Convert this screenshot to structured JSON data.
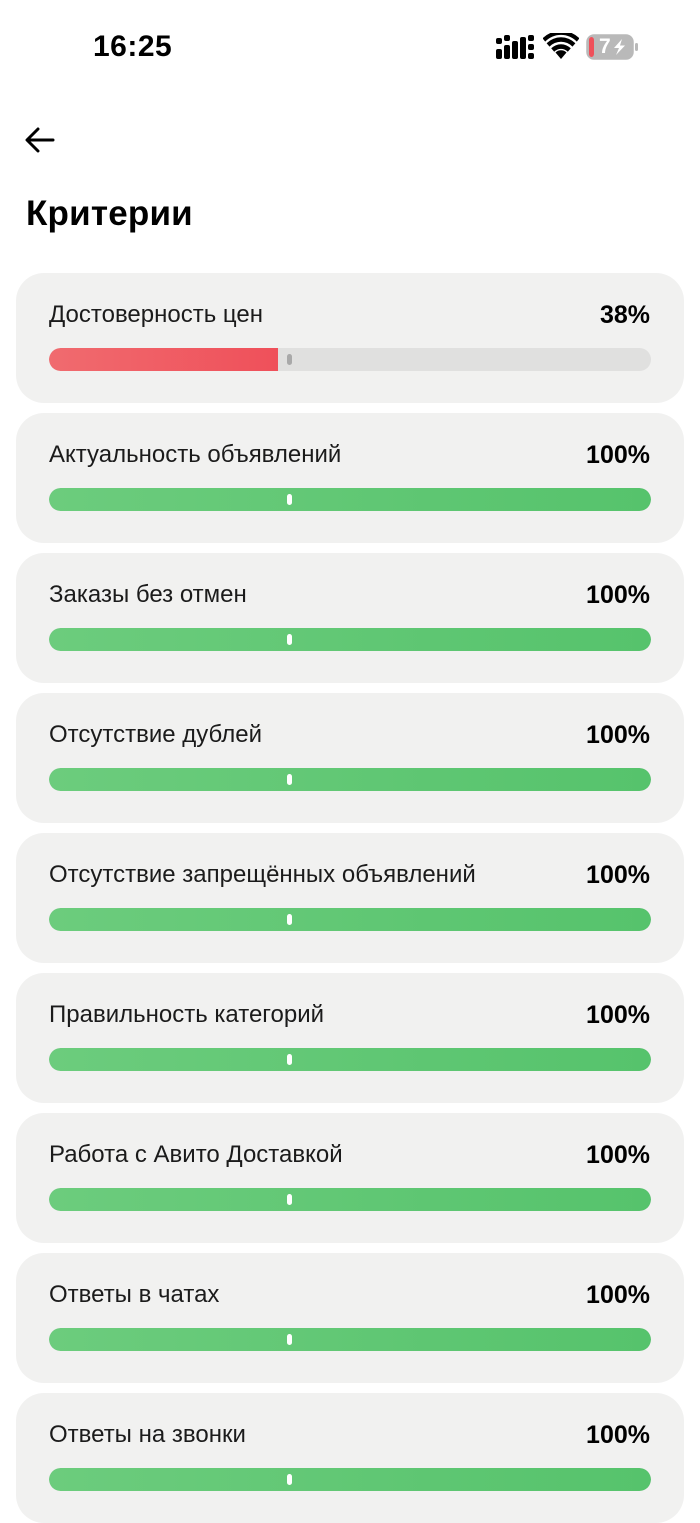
{
  "status_bar": {
    "time": "16:25",
    "battery_level": "7",
    "icons": [
      "signal-icon",
      "wifi-icon",
      "battery-charging-icon"
    ]
  },
  "header": {
    "back_icon": "arrow-left-icon",
    "title": "Критерии"
  },
  "colors": {
    "good": "#56c36c",
    "good_light": "#6ccc7d",
    "bad": "#ef505a",
    "bad_light": "#f06b6f",
    "track": "#e0e0df",
    "card": "#f1f1f0"
  },
  "criteria": [
    {
      "label": "Достоверность цен",
      "percent_text": "38%",
      "progress": 0.38,
      "status": "bad"
    },
    {
      "label": "Актуальность объявлений",
      "percent_text": "100%",
      "progress": 1.0,
      "status": "good"
    },
    {
      "label": "Заказы без отмен",
      "percent_text": "100%",
      "progress": 1.0,
      "status": "good"
    },
    {
      "label": "Отсутствие дублей",
      "percent_text": "100%",
      "progress": 1.0,
      "status": "good"
    },
    {
      "label": "Отсутствие запрещённых объявлений",
      "percent_text": "100%",
      "progress": 1.0,
      "status": "good"
    },
    {
      "label": "Правильность категорий",
      "percent_text": "100%",
      "progress": 1.0,
      "status": "good"
    },
    {
      "label": "Работа с Авито Доставкой",
      "percent_text": "100%",
      "progress": 1.0,
      "status": "good"
    },
    {
      "label": "Ответы в чатах",
      "percent_text": "100%",
      "progress": 1.0,
      "status": "good"
    },
    {
      "label": "Ответы на звонки",
      "percent_text": "100%",
      "progress": 1.0,
      "status": "good"
    }
  ]
}
